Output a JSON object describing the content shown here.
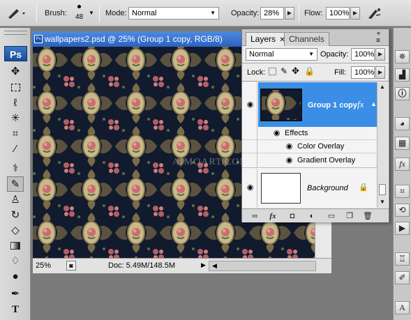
{
  "options_bar": {
    "brush_label": "Brush:",
    "brush_size": "48",
    "mode_label": "Mode:",
    "mode_value": "Normal",
    "opacity_label": "Opacity:",
    "opacity_value": "28%",
    "flow_label": "Flow:",
    "flow_value": "100%"
  },
  "toolbox": {
    "logo": "Ps"
  },
  "document": {
    "title": "wallpapers2.psd @ 25% (Group 1 copy, RGB/8)",
    "zoom": "25%",
    "doc_info": "Doc: 5.49M/148.5M",
    "watermark": "AIMOART.COM"
  },
  "layers_panel": {
    "tab_layers": "Layers",
    "tab_channels": "Channels",
    "blend_mode": "Normal",
    "opacity_label": "Opacity:",
    "opacity_value": "100%",
    "lock_label": "Lock:",
    "fill_label": "Fill:",
    "fill_value": "100%",
    "layers": [
      {
        "name": "Group 1 copy",
        "fx": "fx",
        "selected": true
      },
      {
        "name": "Effects"
      },
      {
        "name": "Color Overlay"
      },
      {
        "name": "Gradient Overlay"
      },
      {
        "name": "Background"
      }
    ]
  },
  "colors": {
    "selection": "#3a8ee6",
    "title_bar": "#2a62c0",
    "canvas_dark": "#111a2c",
    "cartouche": "#c9b98a",
    "rose": "#c96d6d"
  }
}
